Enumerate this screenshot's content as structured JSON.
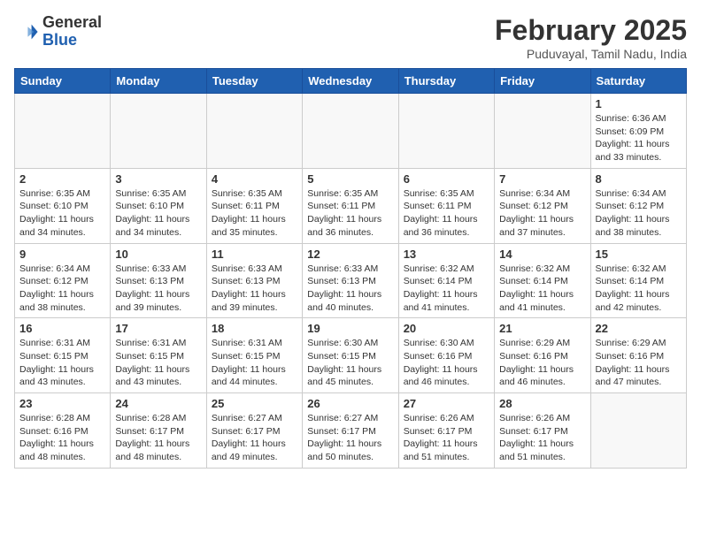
{
  "header": {
    "logo_general": "General",
    "logo_blue": "Blue",
    "month_title": "February 2025",
    "subtitle": "Puduvayal, Tamil Nadu, India"
  },
  "weekdays": [
    "Sunday",
    "Monday",
    "Tuesday",
    "Wednesday",
    "Thursday",
    "Friday",
    "Saturday"
  ],
  "weeks": [
    [
      {
        "day": "",
        "info": ""
      },
      {
        "day": "",
        "info": ""
      },
      {
        "day": "",
        "info": ""
      },
      {
        "day": "",
        "info": ""
      },
      {
        "day": "",
        "info": ""
      },
      {
        "day": "",
        "info": ""
      },
      {
        "day": "1",
        "info": "Sunrise: 6:36 AM\nSunset: 6:09 PM\nDaylight: 11 hours and 33 minutes."
      }
    ],
    [
      {
        "day": "2",
        "info": "Sunrise: 6:35 AM\nSunset: 6:10 PM\nDaylight: 11 hours and 34 minutes."
      },
      {
        "day": "3",
        "info": "Sunrise: 6:35 AM\nSunset: 6:10 PM\nDaylight: 11 hours and 34 minutes."
      },
      {
        "day": "4",
        "info": "Sunrise: 6:35 AM\nSunset: 6:11 PM\nDaylight: 11 hours and 35 minutes."
      },
      {
        "day": "5",
        "info": "Sunrise: 6:35 AM\nSunset: 6:11 PM\nDaylight: 11 hours and 36 minutes."
      },
      {
        "day": "6",
        "info": "Sunrise: 6:35 AM\nSunset: 6:11 PM\nDaylight: 11 hours and 36 minutes."
      },
      {
        "day": "7",
        "info": "Sunrise: 6:34 AM\nSunset: 6:12 PM\nDaylight: 11 hours and 37 minutes."
      },
      {
        "day": "8",
        "info": "Sunrise: 6:34 AM\nSunset: 6:12 PM\nDaylight: 11 hours and 38 minutes."
      }
    ],
    [
      {
        "day": "9",
        "info": "Sunrise: 6:34 AM\nSunset: 6:12 PM\nDaylight: 11 hours and 38 minutes."
      },
      {
        "day": "10",
        "info": "Sunrise: 6:33 AM\nSunset: 6:13 PM\nDaylight: 11 hours and 39 minutes."
      },
      {
        "day": "11",
        "info": "Sunrise: 6:33 AM\nSunset: 6:13 PM\nDaylight: 11 hours and 39 minutes."
      },
      {
        "day": "12",
        "info": "Sunrise: 6:33 AM\nSunset: 6:13 PM\nDaylight: 11 hours and 40 minutes."
      },
      {
        "day": "13",
        "info": "Sunrise: 6:32 AM\nSunset: 6:14 PM\nDaylight: 11 hours and 41 minutes."
      },
      {
        "day": "14",
        "info": "Sunrise: 6:32 AM\nSunset: 6:14 PM\nDaylight: 11 hours and 41 minutes."
      },
      {
        "day": "15",
        "info": "Sunrise: 6:32 AM\nSunset: 6:14 PM\nDaylight: 11 hours and 42 minutes."
      }
    ],
    [
      {
        "day": "16",
        "info": "Sunrise: 6:31 AM\nSunset: 6:15 PM\nDaylight: 11 hours and 43 minutes."
      },
      {
        "day": "17",
        "info": "Sunrise: 6:31 AM\nSunset: 6:15 PM\nDaylight: 11 hours and 43 minutes."
      },
      {
        "day": "18",
        "info": "Sunrise: 6:31 AM\nSunset: 6:15 PM\nDaylight: 11 hours and 44 minutes."
      },
      {
        "day": "19",
        "info": "Sunrise: 6:30 AM\nSunset: 6:15 PM\nDaylight: 11 hours and 45 minutes."
      },
      {
        "day": "20",
        "info": "Sunrise: 6:30 AM\nSunset: 6:16 PM\nDaylight: 11 hours and 46 minutes."
      },
      {
        "day": "21",
        "info": "Sunrise: 6:29 AM\nSunset: 6:16 PM\nDaylight: 11 hours and 46 minutes."
      },
      {
        "day": "22",
        "info": "Sunrise: 6:29 AM\nSunset: 6:16 PM\nDaylight: 11 hours and 47 minutes."
      }
    ],
    [
      {
        "day": "23",
        "info": "Sunrise: 6:28 AM\nSunset: 6:16 PM\nDaylight: 11 hours and 48 minutes."
      },
      {
        "day": "24",
        "info": "Sunrise: 6:28 AM\nSunset: 6:17 PM\nDaylight: 11 hours and 48 minutes."
      },
      {
        "day": "25",
        "info": "Sunrise: 6:27 AM\nSunset: 6:17 PM\nDaylight: 11 hours and 49 minutes."
      },
      {
        "day": "26",
        "info": "Sunrise: 6:27 AM\nSunset: 6:17 PM\nDaylight: 11 hours and 50 minutes."
      },
      {
        "day": "27",
        "info": "Sunrise: 6:26 AM\nSunset: 6:17 PM\nDaylight: 11 hours and 51 minutes."
      },
      {
        "day": "28",
        "info": "Sunrise: 6:26 AM\nSunset: 6:17 PM\nDaylight: 11 hours and 51 minutes."
      },
      {
        "day": "",
        "info": ""
      }
    ]
  ]
}
